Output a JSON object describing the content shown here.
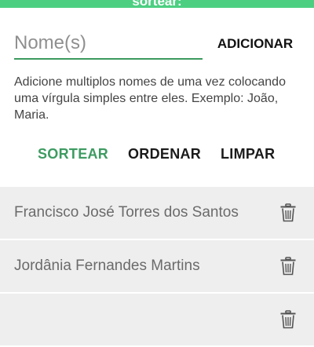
{
  "header": {
    "title": "sortear:",
    "accent_color": "#4dcf82"
  },
  "form": {
    "name_placeholder": "Nome(s)",
    "name_value": "",
    "add_label": "ADICIONAR",
    "hint": "Adicione multiplos nomes de uma vez colocando uma vírgula simples entre eles. Exemplo: João, Maria."
  },
  "actions": {
    "sortear": "SORTEAR",
    "ordenar": "ORDENAR",
    "limpar": "LIMPAR",
    "primary_color": "#3d9b61"
  },
  "list": {
    "items": [
      {
        "name": "Francisco José Torres dos Santos",
        "delete_icon": "trash-icon"
      },
      {
        "name": "Jordânia Fernandes Martins",
        "delete_icon": "trash-icon"
      },
      {
        "name": "",
        "delete_icon": "trash-icon"
      }
    ],
    "row_color": "#eeeeee"
  }
}
